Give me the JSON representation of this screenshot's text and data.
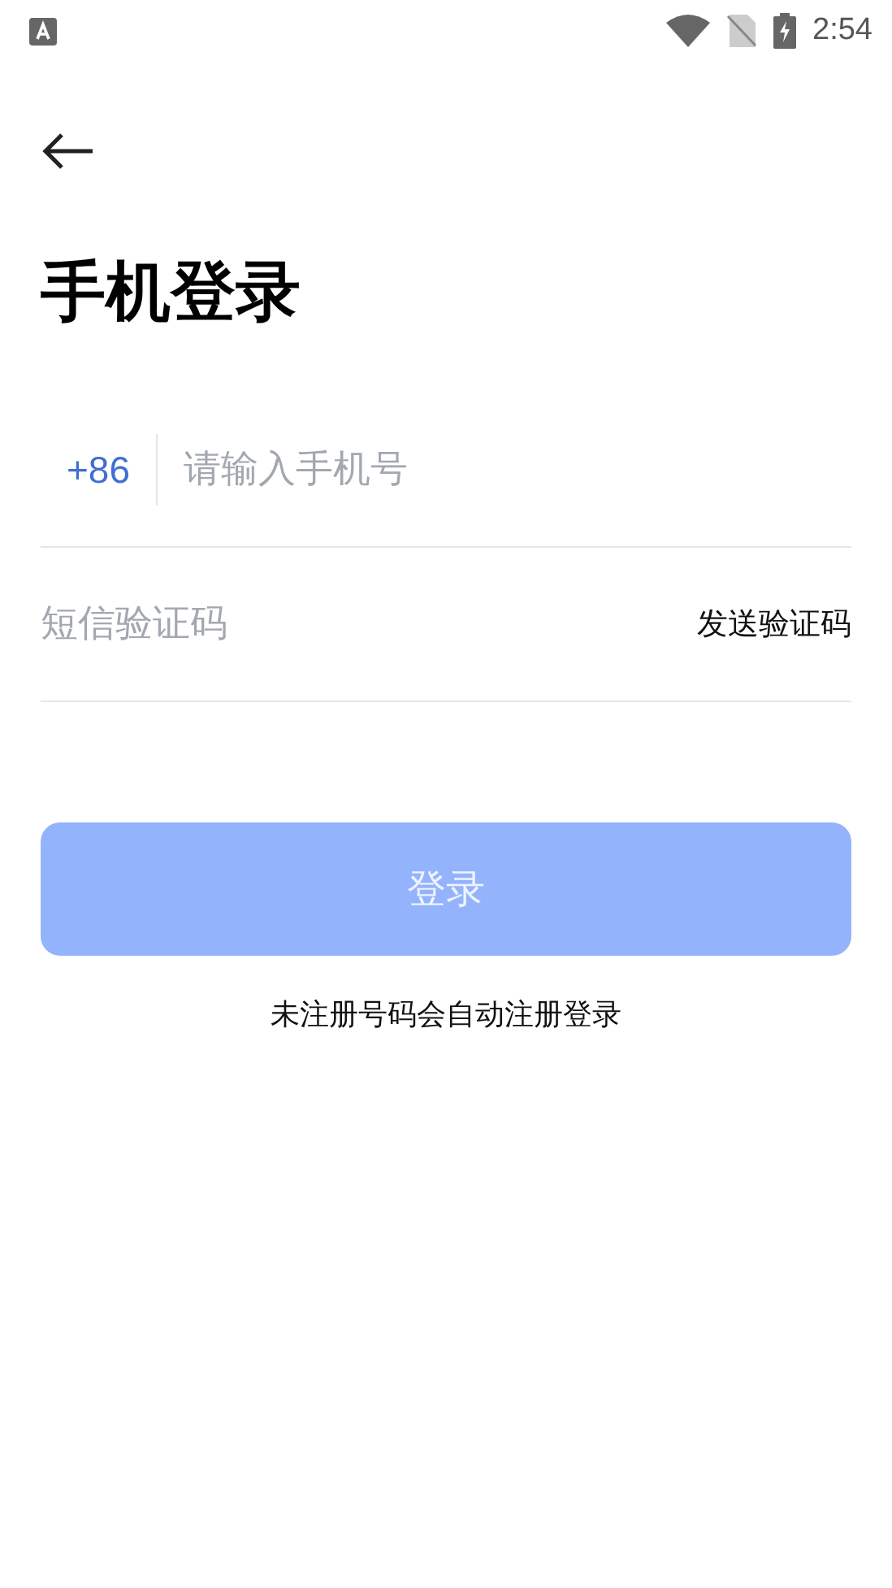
{
  "status_bar": {
    "time": "2:54"
  },
  "title": "手机登录",
  "phone": {
    "country_code": "+86",
    "placeholder": "请输入手机号"
  },
  "code": {
    "placeholder": "短信验证码",
    "send_label": "发送验证码"
  },
  "login_button": {
    "label": "登录",
    "disabled": true
  },
  "note": "未注册号码会自动注册登录"
}
